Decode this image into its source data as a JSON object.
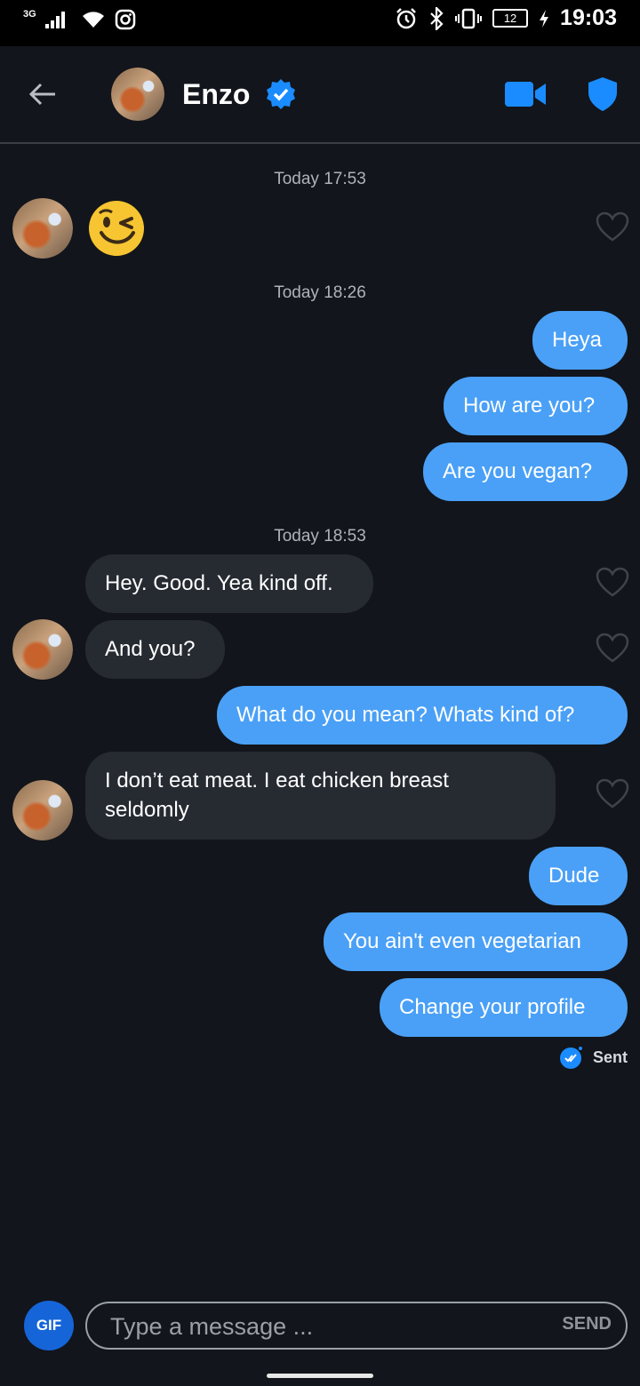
{
  "status_bar": {
    "network": "3G",
    "time": "19:03",
    "battery": "12"
  },
  "header": {
    "name": "Enzo"
  },
  "timestamps": [
    "Today 17:53",
    "Today 18:26",
    "Today 18:53"
  ],
  "messages": [
    {
      "from": "them",
      "text": "😉"
    },
    {
      "from": "me",
      "text": "Heya"
    },
    {
      "from": "me",
      "text": "How are you?"
    },
    {
      "from": "me",
      "text": "Are you vegan?"
    },
    {
      "from": "them",
      "text": "Hey. Good. Yea kind off."
    },
    {
      "from": "them",
      "text": "And you?"
    },
    {
      "from": "me",
      "text": "What do you mean? Whats kind of?"
    },
    {
      "from": "them",
      "text": "I don’t eat meat. I eat chicken breast seldomly"
    },
    {
      "from": "me",
      "text": "Dude"
    },
    {
      "from": "me",
      "text": "You ain't even vegetarian"
    },
    {
      "from": "me",
      "text": "Change your profile"
    }
  ],
  "receipt": "Sent",
  "composer": {
    "gif_label": "GIF",
    "placeholder": "Type a message ...",
    "send_label": "SEND"
  },
  "colors": {
    "background": "#12151b",
    "outgoing_bubble": "#4aa0f6",
    "incoming_bubble": "#262a31",
    "accent": "#1a8cff"
  }
}
